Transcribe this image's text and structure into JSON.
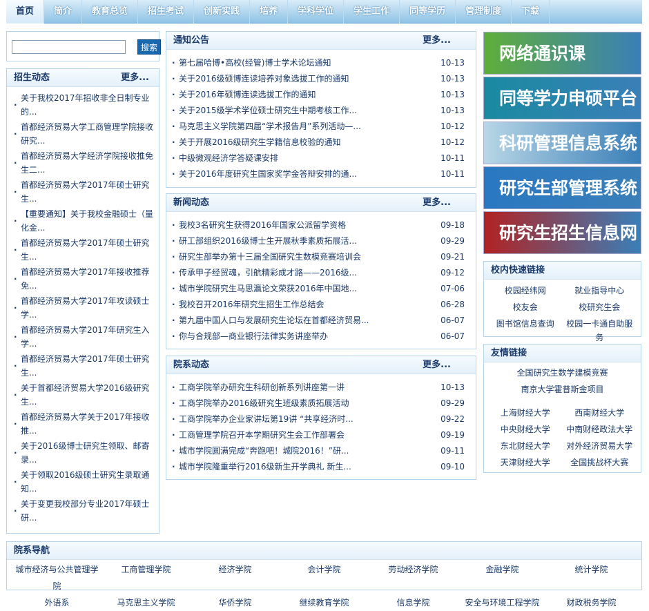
{
  "nav": [
    "首页",
    "简介",
    "教育总览",
    "招生考试",
    "创新实践",
    "培养",
    "学科学位",
    "学生工作",
    "同等学历",
    "管理制度",
    "下载"
  ],
  "search": {
    "button": "搜索",
    "value": ""
  },
  "recruit": {
    "title": "招生动态",
    "more": "更多...",
    "items": [
      "关于我校2017年招收非全日制专业的...",
      "首都经济贸易大学工商管理学院接收研究...",
      "首都经济贸易大学经济学院接收推免生二...",
      "首都经济贸易大学2017年硕士研究生...",
      "【重要通知】关于我校金融硕士（量化金...",
      "首都经济贸易大学2017年硕士研究生...",
      "首都经济贸易大学2017年接收推荐免...",
      "首都经济贸易大学2017年攻读硕士学...",
      "首都经济贸易大学2017年研究生入学...",
      "首都经济贸易大学2017年硕士研究生...",
      "关于首都经济贸易大学2016级研究生...",
      "首都经济贸易大学关于2017年接收推...",
      "关于2016级博士研究生领取、邮寄录...",
      "关于领取2016级硕士研究生录取通知...",
      "关于变更我校部分专业2017年硕士研..."
    ]
  },
  "notice": {
    "title": "通知公告",
    "more": "更多...",
    "items": [
      {
        "t": "第七届哈博•高校(经管)博士学术论坛通知",
        "d": "10-13"
      },
      {
        "t": "关于2016级硕博连读培养对象选拔工作的通知",
        "d": "10-13"
      },
      {
        "t": "关于2016年硕博连读选拔工作的通知",
        "d": "10-13"
      },
      {
        "t": "关于2015级学术学位硕士研究生中期考核工作...",
        "d": "10-13"
      },
      {
        "t": "马克思主义学院第四届“学术报告月”系列活动—...",
        "d": "10-12"
      },
      {
        "t": "关于开展2016级研究生学籍信息校验的通知",
        "d": "10-12"
      },
      {
        "t": "中级微观经济学答疑课安排",
        "d": "10-11"
      },
      {
        "t": "关于2016年度研究生国家奖学金答辩安排的通...",
        "d": "10-11"
      }
    ]
  },
  "newsd": {
    "title": "新闻动态",
    "more": "更多...",
    "items": [
      {
        "t": "我校3名研究生获得2016年国家公派留学资格",
        "d": "09-18"
      },
      {
        "t": "研工部组织2016级博士生开展秋季素质拓展活...",
        "d": "09-29"
      },
      {
        "t": "研究生部举办第十三届全国研究生数模竞赛培训会",
        "d": "09-21"
      },
      {
        "t": "传承甲子经贸魂，引航精彩成才路——2016级...",
        "d": "09-12"
      },
      {
        "t": "城市学院研究生马思瀛论文荣获2016年中国地...",
        "d": "07-06"
      },
      {
        "t": "我校召开2016年研究生招生工作总结会",
        "d": "06-28"
      },
      {
        "t": "第九届中国人口与发展研究生论坛在首都经济贸易...",
        "d": "06-07"
      },
      {
        "t": "你与合规部—商业银行法律实务讲座举办",
        "d": "06-07"
      }
    ]
  },
  "college": {
    "title": "院系动态",
    "more": "更多...",
    "items": [
      {
        "t": "工商学院举办研究生科研创新系列讲座第一讲",
        "d": "10-13"
      },
      {
        "t": "工商学院举办2016级研究生班级素质拓展活动",
        "d": "09-29"
      },
      {
        "t": "工商学院举办企业家讲坛第19讲 “共享经济时...",
        "d": "09-22"
      },
      {
        "t": "工商管理学院召开本学期研究生会工作部署会",
        "d": "09-19"
      },
      {
        "t": "城市学院圆满完成“奔跑吧！城院2016！”研...",
        "d": "09-11"
      },
      {
        "t": "城市学院隆重举行2016级新生开学典礼 新生...",
        "d": "09-10"
      }
    ]
  },
  "banners": [
    {
      "text": "网络通识课",
      "color": "#5fae3a"
    },
    {
      "text": "同等学力申硕平台",
      "color": "#1a8aa0"
    },
    {
      "text": "科研管理信息系统",
      "color": "#b8d6e6"
    },
    {
      "text": "研究生部管理系统",
      "color": "#2a78c2"
    },
    {
      "text": "研究生招生信息网",
      "color": "#b22222"
    }
  ],
  "quick": {
    "title": "校内快速链接",
    "items": [
      "校园经纬网",
      "就业指导中心",
      "校友会",
      "校研究生会",
      "图书馆信息查询",
      "校园一卡通自助服务"
    ]
  },
  "friends": {
    "title": "友情链接",
    "full": [
      "全国研究生数学建模竞赛",
      "南京大学霍普斯金项目"
    ],
    "items": [
      "上海财经大学",
      "西南财经大学",
      "中央财经大学",
      "中南财经政法大学",
      "东北财经大学",
      "对外经济贸易大学",
      "天津财经大学",
      "全国挑战杯大赛"
    ]
  },
  "dept": {
    "title": "院系导航",
    "items": [
      "城市经济与公共管理学院",
      "工商管理学院",
      "经济学院",
      "会计学院",
      "劳动经济学院",
      "金融学院",
      "统计学院",
      "外语系",
      "马克思主义学院",
      "华侨学院",
      "继续教育学院",
      "信息学院",
      "安全与环境工程学院",
      "财政税务学院"
    ]
  }
}
